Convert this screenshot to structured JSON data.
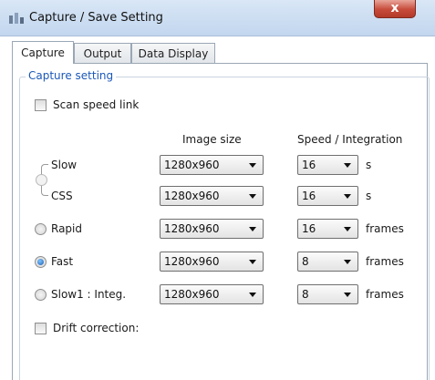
{
  "window": {
    "title": "Capture / Save Setting",
    "close_label": "x"
  },
  "tabs": [
    {
      "label": "Capture",
      "active": true
    },
    {
      "label": "Output",
      "active": false
    },
    {
      "label": "Data Display",
      "active": false
    }
  ],
  "group": {
    "title": "Capture setting",
    "scan_speed_link": {
      "label": "Scan speed link",
      "checked": false
    },
    "columns": {
      "image_size": "Image size",
      "speed": "Speed / Integration"
    },
    "rows": [
      {
        "label": "Slow",
        "image_size": "1280x960",
        "speed": "16",
        "unit": "s"
      },
      {
        "label": "CSS",
        "image_size": "1280x960",
        "speed": "16",
        "unit": "s"
      },
      {
        "label": "Rapid",
        "image_size": "1280x960",
        "speed": "16",
        "unit": "frames",
        "selected": false
      },
      {
        "label": "Fast",
        "image_size": "1280x960",
        "speed": "8",
        "unit": "frames",
        "selected": true
      },
      {
        "label": "Slow1 : Integ.",
        "image_size": "1280x960",
        "speed": "8",
        "unit": "frames",
        "selected": false
      }
    ],
    "drift_correction": {
      "label": "Drift correction:",
      "checked": false
    }
  }
}
